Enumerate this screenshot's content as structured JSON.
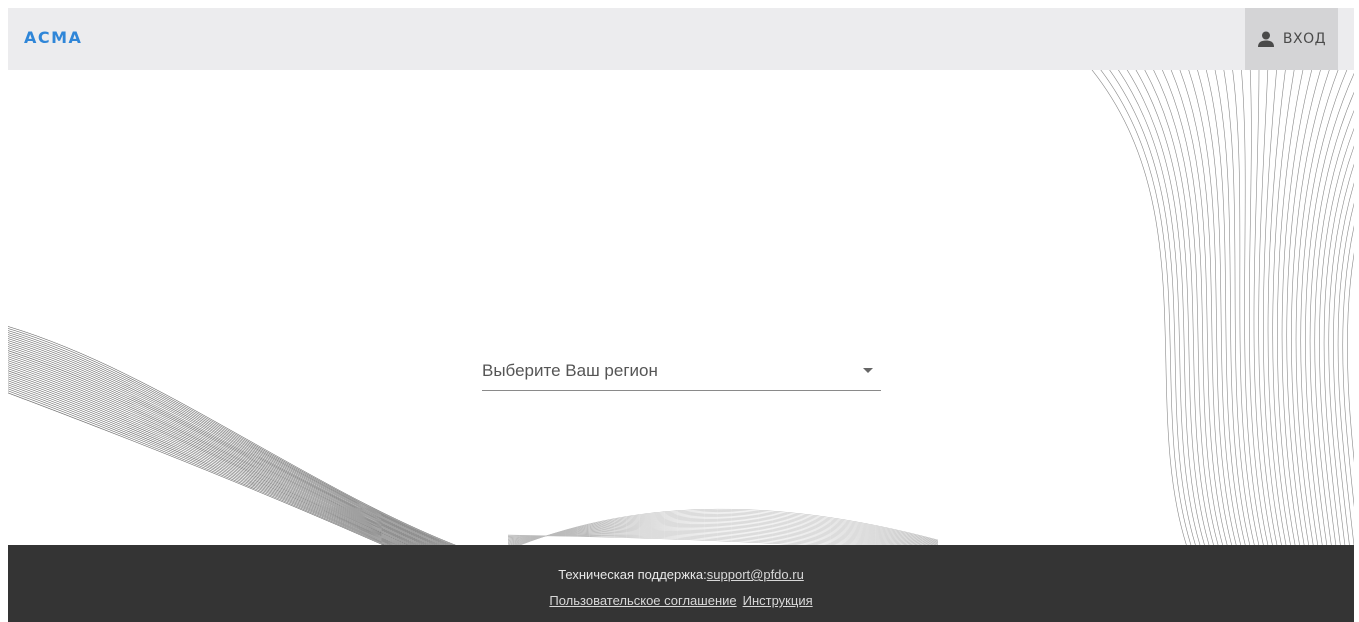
{
  "header": {
    "brand": "АСМА",
    "login": {
      "icon": "user-icon",
      "label": "ВХОД"
    }
  },
  "main": {
    "region_select": {
      "label": "Выберите Ваш регион",
      "icon": "dropdown-arrow-icon"
    }
  },
  "footer": {
    "support_label": "Техническая поддержка:",
    "support_email": "support@pfdo.ru",
    "links": [
      {
        "label": "Пользовательское соглашение"
      },
      {
        "label": "Инструкция"
      }
    ]
  },
  "colors": {
    "brand": "#2f86d8",
    "header_bg": "#ececee",
    "login_bg": "#d4d4d6",
    "footer_bg": "#343434"
  }
}
